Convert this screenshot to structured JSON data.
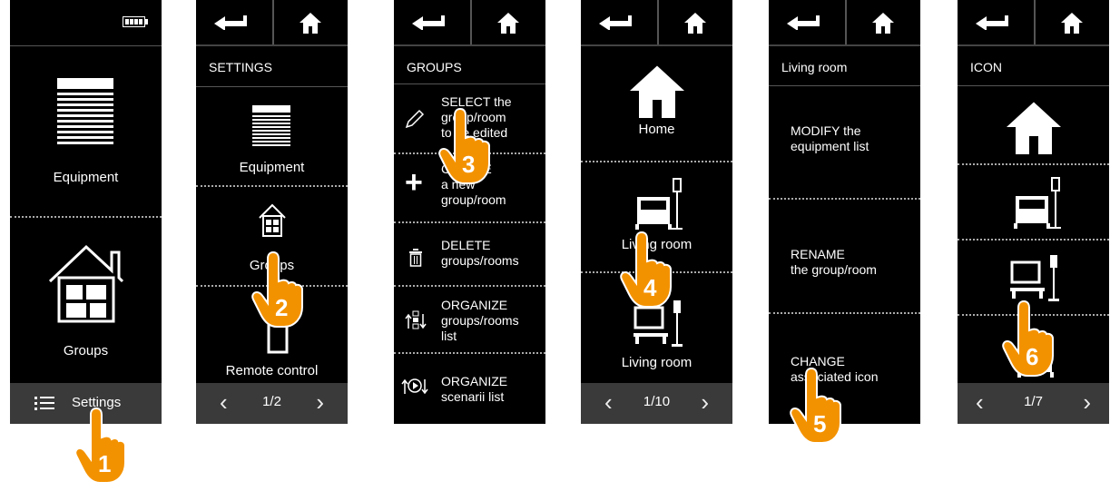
{
  "screen1": {
    "equipment_label": "Equipment",
    "groups_label": "Groups",
    "settings_label": "Settings"
  },
  "screen2": {
    "title": "SETTINGS",
    "equipment_label": "Equipment",
    "groups_label": "Groups",
    "remote_label": "Remote control",
    "page": "1/2"
  },
  "screen3": {
    "title": "GROUPS",
    "rows": [
      {
        "line1": "SELECT the",
        "line2": "group/room",
        "line3": "to be edited"
      },
      {
        "line1": "CREATE",
        "line2": "a new",
        "line3": "group/room"
      },
      {
        "line1": "DELETE",
        "line2": "groups/rooms"
      },
      {
        "line1": "ORGANIZE",
        "line2": "groups/rooms",
        "line3": "list"
      },
      {
        "line1": "ORGANIZE",
        "line2": "scenarii list"
      }
    ]
  },
  "screen4": {
    "home_label": "Home",
    "living1_label": "Living room",
    "living2_label": "Living room",
    "page": "1/10"
  },
  "screen5": {
    "title": "Living room",
    "modify_l1": "MODIFY the",
    "modify_l2": "equipment list",
    "rename_l1": "RENAME",
    "rename_l2": "the group/room",
    "change_l1": "CHANGE",
    "change_l2": "associated icon"
  },
  "screen6": {
    "title": "ICON",
    "page": "1/7"
  },
  "steps": [
    "1",
    "2",
    "3",
    "4",
    "5",
    "6"
  ],
  "colors": {
    "screen_bg": "#000000",
    "bar_bg": "#3a3a3a",
    "hand_orange": "#f39200",
    "text": "#ffffff"
  }
}
